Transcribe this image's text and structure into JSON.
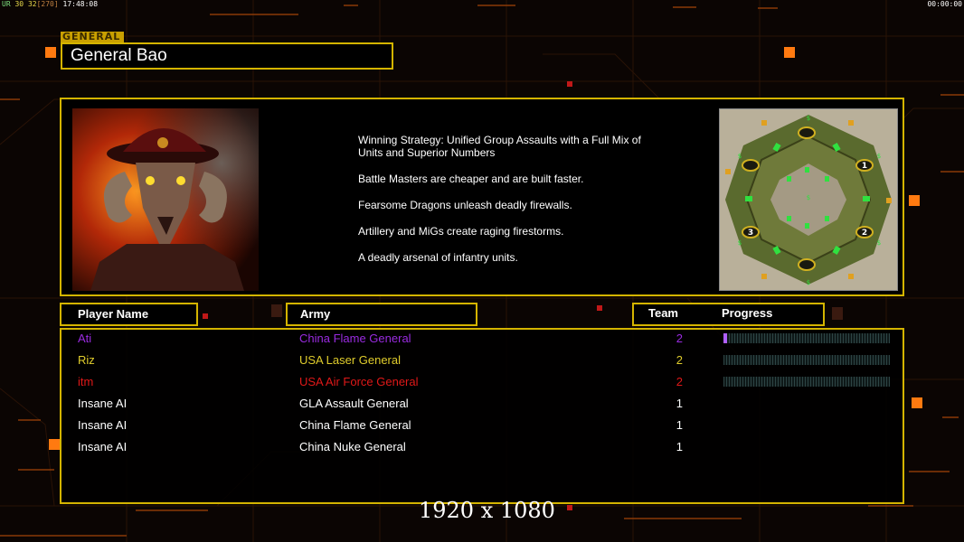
{
  "hud": {
    "left_a": "UR",
    "left_b": "30",
    "left_c": "32",
    "left_d": "[270]",
    "left_time": "17:48:08",
    "right_time": "00:00:00"
  },
  "general": {
    "tag": "GENERAL",
    "name": "General Bao",
    "portrait": "general-bao-portrait",
    "strategy": [
      "Winning Strategy: Unified Group Assaults with a Full Mix of Units and Superior Numbers",
      "Battle Masters are cheaper and are built faster.",
      "Fearsome Dragons unleash deadly firewalls.",
      "Artillery and MiGs create raging firestorms.",
      "A deadly arsenal of infantry units."
    ],
    "map_labels": [
      "1",
      "2",
      "3"
    ],
    "map_money_symbol": "$"
  },
  "table": {
    "headers": {
      "player": "Player Name",
      "army": "Army",
      "team": "Team",
      "progress": "Progress"
    },
    "rows": [
      {
        "player": "Ati",
        "army": "China Flame General",
        "team": "2",
        "color": "#9a2be0",
        "progress": 0.02
      },
      {
        "player": "Riz",
        "army": "USA Laser General",
        "team": "2",
        "color": "#e0cc2c",
        "progress": 0
      },
      {
        "player": "itm",
        "army": "USA Air Force General",
        "team": "2",
        "color": "#e01818",
        "progress": 0
      },
      {
        "player": "Insane AI",
        "army": "GLA Assault General",
        "team": "1",
        "color": "#ffffff"
      },
      {
        "player": "Insane AI",
        "army": "China Flame General",
        "team": "1",
        "color": "#ffffff"
      },
      {
        "player": "Insane AI",
        "army": "China Nuke General",
        "team": "1",
        "color": "#ffffff"
      }
    ]
  },
  "overlay": {
    "resolution": "1920 x 1080"
  },
  "colors": {
    "accent": "#d4b400",
    "background": "#0b0503",
    "orange": "#ff7a10"
  }
}
